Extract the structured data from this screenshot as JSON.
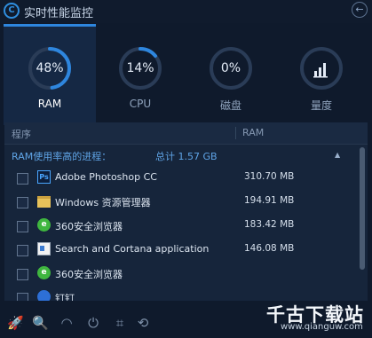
{
  "window": {
    "title": "实时性能监控"
  },
  "gauges": [
    {
      "label": "RAM",
      "value": "48%",
      "percent": 48,
      "active": true
    },
    {
      "label": "CPU",
      "value": "14%",
      "percent": 14,
      "active": false
    },
    {
      "label": "磁盘",
      "value": "0%",
      "percent": 0,
      "active": false
    },
    {
      "label": "量度",
      "value": "",
      "icon": "bar-chart-icon",
      "active": false
    }
  ],
  "table": {
    "col_process": "程序",
    "col_ram": "RAM",
    "group_title": "RAM使用率高的进程：",
    "group_total": "总计  1.57 GB",
    "rows": [
      {
        "name": "Adobe Photoshop CC",
        "size": "310.70 MB",
        "icon": "photoshop-icon",
        "icon_text": "Ps"
      },
      {
        "name": "Windows 资源管理器",
        "size": "194.91 MB",
        "icon": "folder-icon",
        "icon_text": ""
      },
      {
        "name": "360安全浏览器",
        "size": "183.42 MB",
        "icon": "360-browser-icon",
        "icon_text": "e"
      },
      {
        "name": "Search and Cortana application",
        "size": "146.08 MB",
        "icon": "app-window-icon",
        "icon_text": ""
      },
      {
        "name": "360安全浏览器",
        "size": "",
        "icon": "360-browser-icon",
        "icon_text": "e"
      },
      {
        "name": "钉钉",
        "size": "",
        "icon": "dingtalk-icon",
        "icon_text": ""
      }
    ]
  },
  "toolbar": [
    {
      "name": "rocket-icon",
      "glyph": "🚀"
    },
    {
      "name": "search-icon",
      "glyph": "🔍"
    },
    {
      "name": "speed-icon",
      "glyph": "◠"
    },
    {
      "name": "power-icon",
      "glyph": "⏻"
    },
    {
      "name": "crop-icon",
      "glyph": "⌗"
    },
    {
      "name": "sync-icon",
      "glyph": "⟲"
    }
  ],
  "watermark": {
    "text": "千古下载站",
    "url": "www.qianguw.com"
  },
  "colors": {
    "accent": "#2e86de",
    "background": "#0f1a2c"
  }
}
